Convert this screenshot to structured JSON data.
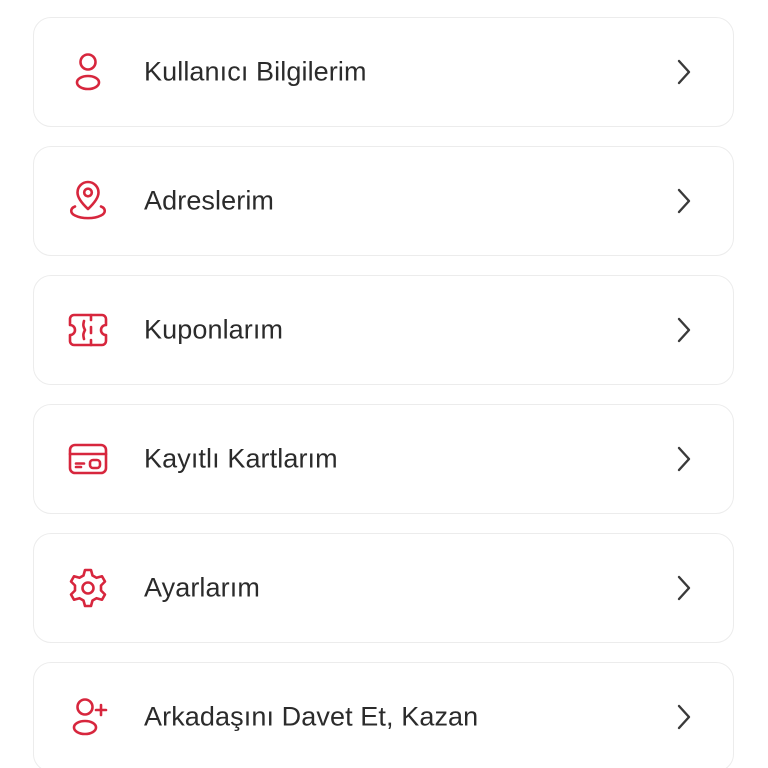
{
  "theme": {
    "accent": "#d7263d",
    "text": "#2b2b2b",
    "chevron": "#3a3a3a",
    "card_border": "#ececec"
  },
  "menu": {
    "items": [
      {
        "label": "Kullanıcı Bilgilerim",
        "icon": "user-icon"
      },
      {
        "label": "Adreslerim",
        "icon": "location-pin-icon"
      },
      {
        "label": "Kuponlarım",
        "icon": "ticket-icon"
      },
      {
        "label": "Kayıtlı Kartlarım",
        "icon": "credit-card-icon"
      },
      {
        "label": "Ayarlarım",
        "icon": "gear-icon"
      },
      {
        "label": "Arkadaşını Davet Et, Kazan",
        "icon": "add-user-icon"
      }
    ]
  }
}
